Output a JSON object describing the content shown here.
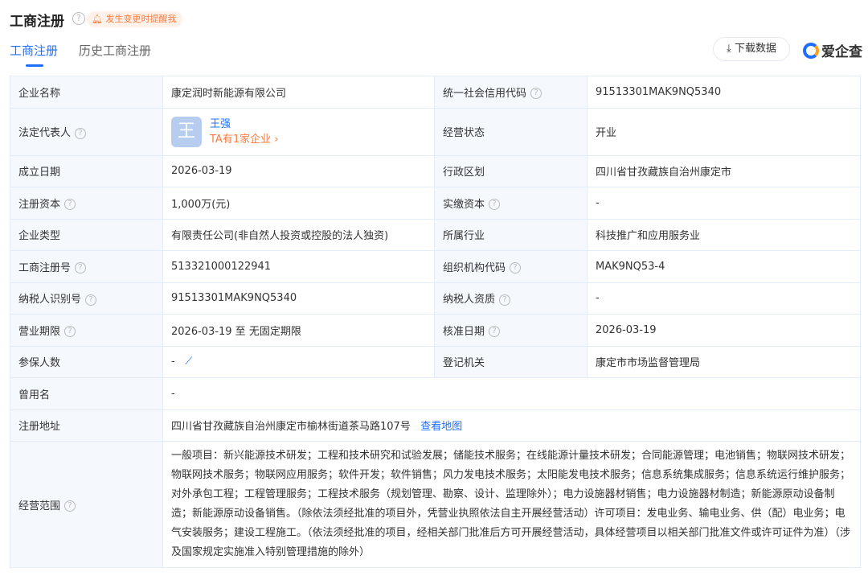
{
  "header": {
    "title": "工商注册",
    "remind": "发生变更时提醒我",
    "download": "下载数据",
    "brand": "爱企查",
    "help": "?"
  },
  "tabs": [
    "工商注册",
    "历史工商注册"
  ],
  "rows": {
    "company_name": {
      "label": "企业名称",
      "value": "康定润时新能源有限公司"
    },
    "credit_code": {
      "label": "统一社会信用代码",
      "value": "91513301MAK9NQ5340"
    },
    "legal_rep": {
      "label": "法定代表人",
      "avatar": "王",
      "name": "王强",
      "companies": "TA有1家企业 ›"
    },
    "status": {
      "label": "经营状态",
      "value": "开业"
    },
    "founded": {
      "label": "成立日期",
      "value": "2026-03-19"
    },
    "region": {
      "label": "行政区划",
      "value": "四川省甘孜藏族自治州康定市"
    },
    "capital": {
      "label": "注册资本",
      "value": "1,000万(元)"
    },
    "paid_capital": {
      "label": "实缴资本",
      "value": "-"
    },
    "type": {
      "label": "企业类型",
      "value": "有限责任公司(非自然人投资或控股的法人独资)"
    },
    "industry": {
      "label": "所属行业",
      "value": "科技推广和应用服务业"
    },
    "reg_no": {
      "label": "工商注册号",
      "value": "513321000122941"
    },
    "org_code": {
      "label": "组织机构代码",
      "value": "MAK9NQ53-4"
    },
    "taxpayer_id": {
      "label": "纳税人识别号",
      "value": "91513301MAK9NQ5340"
    },
    "taxpayer_qual": {
      "label": "纳税人资质",
      "value": "-"
    },
    "term": {
      "label": "营业期限",
      "value": "2026-03-19 至 无固定期限"
    },
    "approve_date": {
      "label": "核准日期",
      "value": "2026-03-19"
    },
    "insured": {
      "label": "参保人数",
      "value": "-"
    },
    "authority": {
      "label": "登记机关",
      "value": "康定市市场监督管理局"
    },
    "former_name": {
      "label": "曾用名",
      "value": "-"
    },
    "address": {
      "label": "注册地址",
      "value": "四川省甘孜藏族自治州康定市榆林街道茶马路107号",
      "map": "查看地图"
    },
    "scope": {
      "label": "经营范围",
      "value": "一般项目：新兴能源技术研发；工程和技术研究和试验发展；储能技术服务；在线能源计量技术研发；合同能源管理；电池销售；物联网技术研发；物联网技术服务；物联网应用服务；软件开发；软件销售；风力发电技术服务；太阳能发电技术服务；信息系统集成服务；信息系统运行维护服务；对外承包工程；工程管理服务；工程技术服务（规划管理、勘察、设计、监理除外）；电力设施器材销售；电力设施器材制造；新能源原动设备制造；新能源原动设备销售。（除依法须经批准的项目外，凭营业执照依法自主开展经营活动）许可项目：发电业务、输电业务、供（配）电业务；电气安装服务；建设工程施工。（依法须经批准的项目，经相关部门批准后方可开展经营活动，具体经营项目以相关部门批准文件或许可证件为准）（涉及国家规定实施准入特别管理措施的除外）"
    }
  }
}
